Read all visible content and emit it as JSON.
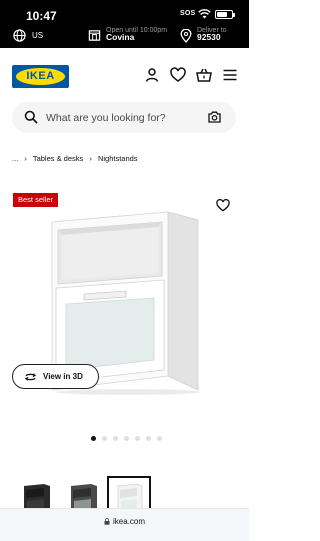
{
  "status_bar": {
    "time": "10:47",
    "sos": "SOS"
  },
  "store_bar": {
    "country": "US",
    "store_caption": "Open until 10:00pm",
    "store_name": "Covina",
    "deliver_caption": "Deliver to",
    "zip": "92530"
  },
  "header": {
    "logo": "IKEA"
  },
  "search": {
    "placeholder": "What are you looking for?"
  },
  "breadcrumb": [
    "...",
    "Tables & desks",
    "Nightstands"
  ],
  "product": {
    "badge": "Best seller",
    "view_3d_label": "View in 3D"
  },
  "carousel": {
    "total": 7,
    "active_index": 0
  },
  "thumbnails": [
    "black-brown",
    "dark-gray",
    "white"
  ],
  "browser": {
    "url": "ikea.com"
  },
  "colors": {
    "ikea_blue": "#0058a3",
    "ikea_yellow": "#ffdb00",
    "badge_red": "#cc0008"
  },
  "icons": [
    "globe-icon",
    "store-icon",
    "location-pin-icon",
    "account-icon",
    "heart-icon",
    "cart-icon",
    "menu-icon",
    "search-icon",
    "camera-icon",
    "rotate-3d-icon",
    "lock-icon"
  ]
}
